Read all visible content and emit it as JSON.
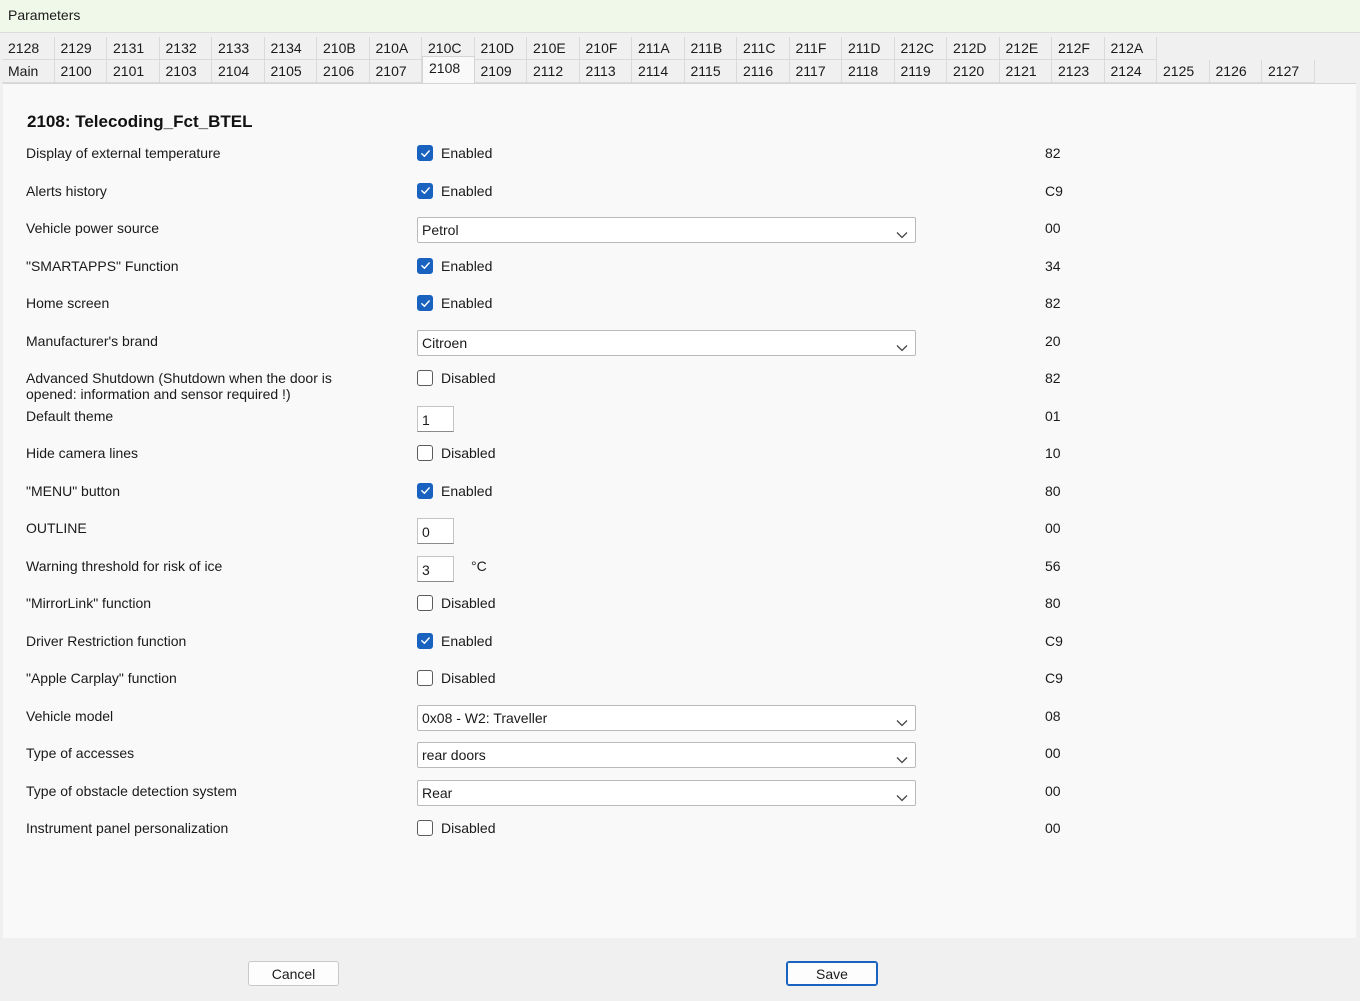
{
  "window": {
    "title": "Parameters"
  },
  "tabs_row1": [
    "2128",
    "2129",
    "2131",
    "2132",
    "2133",
    "2134",
    "210B",
    "210A",
    "210C",
    "210D",
    "210E",
    "210F",
    "211A",
    "211B",
    "211C",
    "211F",
    "211D",
    "212C",
    "212D",
    "212E",
    "212F",
    "212A"
  ],
  "tabs_row2": [
    "Main",
    "2100",
    "2101",
    "2103",
    "2104",
    "2105",
    "2106",
    "2107",
    "2108",
    "2109",
    "2112",
    "2113",
    "2114",
    "2115",
    "2116",
    "2117",
    "2118",
    "2119",
    "2120",
    "2121",
    "2123",
    "2124",
    "2125",
    "2126",
    "2127"
  ],
  "active_tab": "2108",
  "panel": {
    "heading": "2108: Telecoding_Fct_BTEL"
  },
  "params": [
    {
      "label": "Display of external temperature",
      "type": "checkbox",
      "checked": true,
      "value": "Enabled",
      "hex": "82"
    },
    {
      "label": "Alerts history",
      "type": "checkbox",
      "checked": true,
      "value": "Enabled",
      "hex": "C9"
    },
    {
      "label": "Vehicle power source",
      "type": "select",
      "value": "Petrol",
      "hex": "00"
    },
    {
      "label": "\"SMARTAPPS\" Function",
      "type": "checkbox",
      "checked": true,
      "value": "Enabled",
      "hex": "34"
    },
    {
      "label": "Home screen",
      "type": "checkbox",
      "checked": true,
      "value": "Enabled",
      "hex": "82"
    },
    {
      "label": "Manufacturer's brand",
      "type": "select",
      "value": "Citroen",
      "hex": "20"
    },
    {
      "label": "Advanced Shutdown (Shutdown when the door is opened: information and sensor required !)",
      "type": "checkbox",
      "checked": false,
      "value": "Disabled",
      "hex": "82"
    },
    {
      "label": "Default theme",
      "type": "number",
      "value": "1",
      "hex": "01"
    },
    {
      "label": "Hide camera lines",
      "type": "checkbox",
      "checked": false,
      "value": "Disabled",
      "hex": "10"
    },
    {
      "label": "\"MENU\" button",
      "type": "checkbox",
      "checked": true,
      "value": "Enabled",
      "hex": "80"
    },
    {
      "label": "OUTLINE",
      "type": "number",
      "value": "0",
      "hex": "00"
    },
    {
      "label": "Warning threshold for risk of ice",
      "type": "number",
      "value": "3",
      "unit": "°C",
      "hex": "56"
    },
    {
      "label": "\"MirrorLink\" function",
      "type": "checkbox",
      "checked": false,
      "value": "Disabled",
      "hex": "80"
    },
    {
      "label": "Driver Restriction function",
      "type": "checkbox",
      "checked": true,
      "value": "Enabled",
      "hex": "C9"
    },
    {
      "label": "\"Apple Carplay\" function",
      "type": "checkbox",
      "checked": false,
      "value": "Disabled",
      "hex": "C9"
    },
    {
      "label": "Vehicle model",
      "type": "select",
      "value": "0x08 - W2: Traveller",
      "hex": "08"
    },
    {
      "label": "Type of accesses",
      "type": "select",
      "value": "rear doors",
      "hex": "00"
    },
    {
      "label": "Type of obstacle detection system",
      "type": "select",
      "value": "Rear",
      "hex": "00"
    },
    {
      "label": "Instrument panel personalization",
      "type": "checkbox",
      "checked": false,
      "value": "Disabled",
      "hex": "00"
    }
  ],
  "buttons": {
    "cancel": "Cancel",
    "save": "Save"
  },
  "colors": {
    "accent": "#1a62c0",
    "titlebar": "#f0f8ea"
  }
}
